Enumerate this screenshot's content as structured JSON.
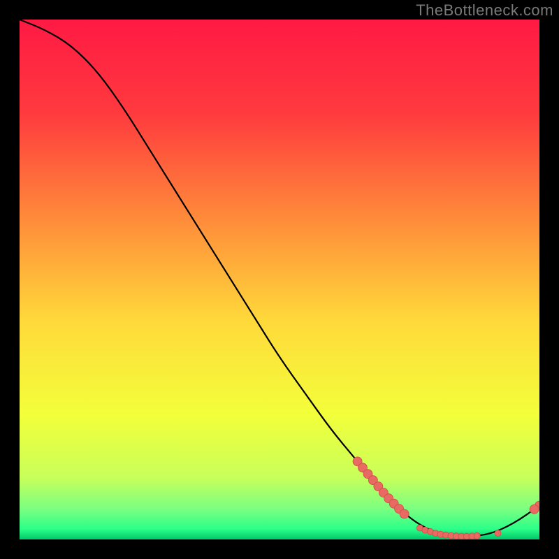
{
  "watermark": "TheBottleneck.com",
  "colors": {
    "background": "#000000",
    "gradient_top": "#ff1a44",
    "gradient_mid_upper": "#ff6a3a",
    "gradient_mid": "#ffd93a",
    "gradient_mid_lower": "#f3ff3a",
    "gradient_green_light": "#9dff7a",
    "gradient_green": "#2bff88",
    "gradient_green_deep": "#00c86a",
    "curve": "#000000",
    "marker_fill": "#e86a62",
    "marker_stroke": "#c94f47"
  },
  "chart_data": {
    "type": "line",
    "title": "",
    "xlabel": "",
    "ylabel": "",
    "xlim": [
      0,
      100
    ],
    "ylim": [
      0,
      100
    ],
    "comment": "Approximate bottleneck-style curve: y-axis is gap/bottleneck %, optimum zone ~x=77-92, curve descends from top-left, flattens near 0 at optimum, rises slightly past it.",
    "curve": [
      {
        "x": 0,
        "y": 100
      },
      {
        "x": 5,
        "y": 98
      },
      {
        "x": 10,
        "y": 95
      },
      {
        "x": 15,
        "y": 90
      },
      {
        "x": 20,
        "y": 83
      },
      {
        "x": 25,
        "y": 75
      },
      {
        "x": 30,
        "y": 67
      },
      {
        "x": 35,
        "y": 59
      },
      {
        "x": 40,
        "y": 51
      },
      {
        "x": 45,
        "y": 43
      },
      {
        "x": 50,
        "y": 35
      },
      {
        "x": 55,
        "y": 28
      },
      {
        "x": 60,
        "y": 21
      },
      {
        "x": 65,
        "y": 15
      },
      {
        "x": 70,
        "y": 9
      },
      {
        "x": 75,
        "y": 4
      },
      {
        "x": 80,
        "y": 1.2
      },
      {
        "x": 85,
        "y": 0.6
      },
      {
        "x": 90,
        "y": 0.8
      },
      {
        "x": 95,
        "y": 3
      },
      {
        "x": 100,
        "y": 6.5
      }
    ],
    "markers_large": [
      {
        "x": 65,
        "y": 15
      },
      {
        "x": 66,
        "y": 13.8
      },
      {
        "x": 67,
        "y": 12.6
      },
      {
        "x": 68,
        "y": 11.4
      },
      {
        "x": 69,
        "y": 10.2
      },
      {
        "x": 70,
        "y": 9.0
      },
      {
        "x": 71,
        "y": 7.9
      },
      {
        "x": 72,
        "y": 6.9
      },
      {
        "x": 73,
        "y": 5.9
      },
      {
        "x": 74,
        "y": 4.9
      },
      {
        "x": 100,
        "y": 6.5
      },
      {
        "x": 99,
        "y": 5.8
      }
    ],
    "markers_small": [
      {
        "x": 77,
        "y": 2.2
      },
      {
        "x": 78,
        "y": 1.8
      },
      {
        "x": 79,
        "y": 1.5
      },
      {
        "x": 80,
        "y": 1.2
      },
      {
        "x": 81,
        "y": 1.0
      },
      {
        "x": 82,
        "y": 0.85
      },
      {
        "x": 83,
        "y": 0.72
      },
      {
        "x": 84,
        "y": 0.65
      },
      {
        "x": 85,
        "y": 0.6
      },
      {
        "x": 86,
        "y": 0.6
      },
      {
        "x": 87,
        "y": 0.63
      },
      {
        "x": 88,
        "y": 0.7
      },
      {
        "x": 92,
        "y": 1.2
      }
    ]
  }
}
